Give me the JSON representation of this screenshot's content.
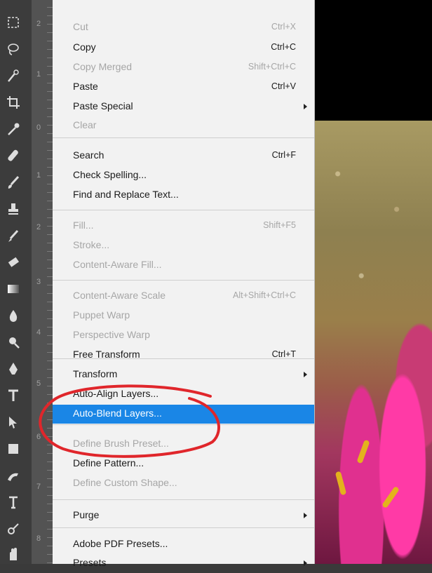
{
  "menu": {
    "items": [
      {
        "label": "Cut",
        "shortcut": "Ctrl+X",
        "enabled": false
      },
      {
        "label": "Copy",
        "shortcut": "Ctrl+C",
        "enabled": true
      },
      {
        "label": "Copy Merged",
        "shortcut": "Shift+Ctrl+C",
        "enabled": false
      },
      {
        "label": "Paste",
        "shortcut": "Ctrl+V",
        "enabled": true
      },
      {
        "label": "Paste Special",
        "shortcut": "",
        "enabled": true,
        "submenu": true
      },
      {
        "label": "Clear",
        "shortcut": "",
        "enabled": false
      },
      {
        "label": "Search",
        "shortcut": "Ctrl+F",
        "enabled": true
      },
      {
        "label": "Check Spelling...",
        "shortcut": "",
        "enabled": true
      },
      {
        "label": "Find and Replace Text...",
        "shortcut": "",
        "enabled": true
      },
      {
        "label": "Fill...",
        "shortcut": "Shift+F5",
        "enabled": false
      },
      {
        "label": "Stroke...",
        "shortcut": "",
        "enabled": false
      },
      {
        "label": "Content-Aware Fill...",
        "shortcut": "",
        "enabled": false
      },
      {
        "label": "Content-Aware Scale",
        "shortcut": "Alt+Shift+Ctrl+C",
        "enabled": false
      },
      {
        "label": "Puppet Warp",
        "shortcut": "",
        "enabled": false
      },
      {
        "label": "Perspective Warp",
        "shortcut": "",
        "enabled": false
      },
      {
        "label": "Free Transform",
        "shortcut": "Ctrl+T",
        "enabled": true
      },
      {
        "label": "Transform",
        "shortcut": "",
        "enabled": true,
        "submenu": true
      },
      {
        "label": "Auto-Align Layers...",
        "shortcut": "",
        "enabled": true
      },
      {
        "label": "Auto-Blend Layers...",
        "shortcut": "",
        "enabled": true,
        "highlighted": true
      },
      {
        "label": "Define Brush Preset...",
        "shortcut": "",
        "enabled": false
      },
      {
        "label": "Define Pattern...",
        "shortcut": "",
        "enabled": true
      },
      {
        "label": "Define Custom Shape...",
        "shortcut": "",
        "enabled": false
      },
      {
        "label": "Purge",
        "shortcut": "",
        "enabled": true,
        "submenu": true
      },
      {
        "label": "Adobe PDF Presets...",
        "shortcut": "",
        "enabled": true
      },
      {
        "label": "Presets",
        "shortcut": "",
        "enabled": true,
        "submenu": true
      }
    ]
  },
  "ruler": {
    "numbers": [
      "2",
      "1",
      "0",
      "1",
      "2",
      "3",
      "4",
      "5",
      "6",
      "7",
      "8"
    ]
  },
  "toolbar": {
    "tools": [
      "marquee-icon",
      "lasso-icon",
      "quick-select-icon",
      "crop-icon",
      "eyedropper-icon",
      "healing-brush-icon",
      "brush-icon",
      "clone-stamp-icon",
      "history-brush-icon",
      "eraser-icon",
      "gradient-icon",
      "blur-icon",
      "dodge-icon",
      "pen-icon",
      "type-icon",
      "path-select-icon",
      "shape-icon",
      "hand-icon"
    ]
  },
  "colors": {
    "highlight": "#1a86e6",
    "annotation": "#e0262b",
    "menu_bg": "#f2f2f2"
  }
}
